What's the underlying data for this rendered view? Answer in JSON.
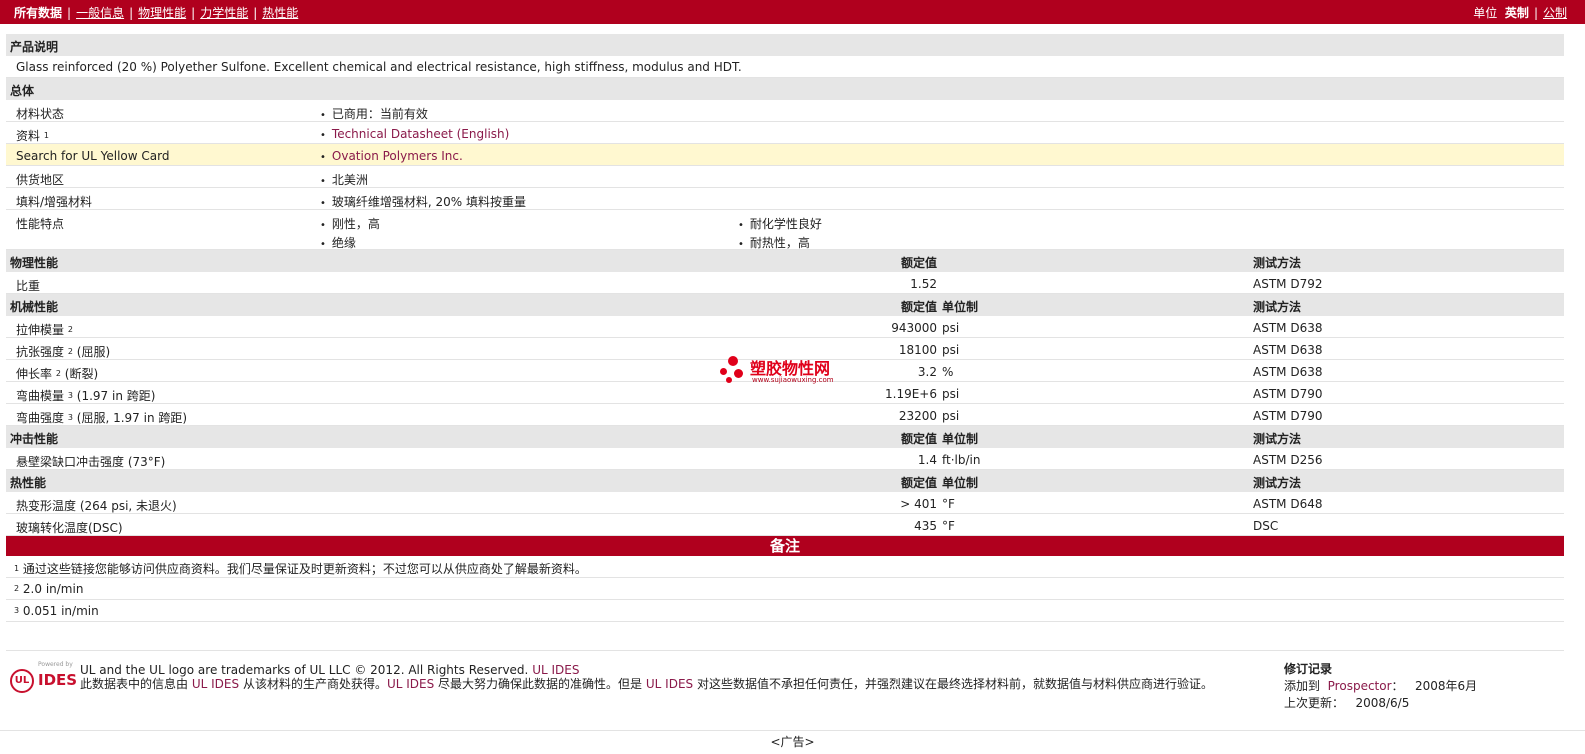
{
  "topbar": {
    "nav": [
      "所有数据",
      "一般信息",
      "物理性能",
      "力学性能",
      "热性能"
    ],
    "units_label": "单位",
    "unit_en": "英制",
    "unit_metric": "公制"
  },
  "desc_section": {
    "title": "产品说明",
    "text": "Glass reinforced (20 %) Polyether Sulfone. Excellent chemical and electrical resistance, high stiffness, modulus and HDT."
  },
  "general": {
    "title": "总体",
    "rows": [
      {
        "label": "材料状态",
        "value": "已商用：当前有效"
      },
      {
        "label": "资料",
        "sup": "1",
        "value": "Technical Datasheet (English)"
      },
      {
        "label": "Search for UL Yellow Card",
        "value": "Ovation Polymers Inc."
      },
      {
        "label": "供货地区",
        "value": "北美洲"
      },
      {
        "label": "填料/增强材料",
        "value": "玻璃纤维增强材料, 20% 填料按重量"
      }
    ],
    "features": {
      "label": "性能特点",
      "items": [
        "刚性，高",
        "绝缘",
        "耐化学性良好",
        "耐热性，高"
      ]
    }
  },
  "physical": {
    "title": "物理性能",
    "col_value": "额定值",
    "col_test": "测试方法",
    "rows": [
      {
        "label": "比重",
        "value": "1.52",
        "unit": "",
        "test": "ASTM D792"
      }
    ]
  },
  "mechanical": {
    "title": "机械性能",
    "col_value": "额定值",
    "col_unit": "单位制",
    "col_test": "测试方法",
    "rows": [
      {
        "label": "拉伸模量",
        "sup": "2",
        "note": "",
        "value": "943000",
        "unit": "psi",
        "test": "ASTM D638"
      },
      {
        "label": "抗张强度",
        "sup": "2",
        "note": "(屈服)",
        "value": "18100",
        "unit": "psi",
        "test": "ASTM D638"
      },
      {
        "label": "伸长率",
        "sup": "2",
        "note": "(断裂)",
        "value": "3.2",
        "unit": "%",
        "test": "ASTM D638"
      },
      {
        "label": "弯曲模量",
        "sup": "3",
        "note": "(1.97 in 跨距)",
        "value": "1.19E+6",
        "unit": "psi",
        "test": "ASTM D790"
      },
      {
        "label": "弯曲强度",
        "sup": "3",
        "note": "(屈服, 1.97 in 跨距)",
        "value": "23200",
        "unit": "psi",
        "test": "ASTM D790"
      }
    ]
  },
  "impact": {
    "title": "冲击性能",
    "col_value": "额定值",
    "col_unit": "单位制",
    "col_test": "测试方法",
    "rows": [
      {
        "label": "悬壁梁缺口冲击强度 (73°F)",
        "value": "1.4",
        "unit": "ft·lb/in",
        "test": "ASTM D256"
      }
    ]
  },
  "thermal": {
    "title": "热性能",
    "col_value": "额定值",
    "col_unit": "单位制",
    "col_test": "测试方法",
    "rows": [
      {
        "label": "热变形温度 (264 psi, 未退火)",
        "value": "> 401",
        "unit": "°F",
        "test": "ASTM D648"
      },
      {
        "label": "玻璃转化温度(DSC)",
        "value": "435",
        "unit": "°F",
        "test": "DSC"
      }
    ]
  },
  "notes": {
    "title": "备注",
    "items": [
      {
        "sup": "1",
        "text": "通过这些链接您能够访问供应商资料。我们尽量保证及时更新资料；不过您可以从供应商处了解最新资料。"
      },
      {
        "sup": "2",
        "text": "2.0 in/min"
      },
      {
        "sup": "3",
        "text": "0.051 in/min"
      }
    ]
  },
  "watermark": {
    "title": "塑胶物性网",
    "url": "www.sujiaowuxing.com"
  },
  "footer": {
    "logo_powered": "Powered by",
    "logo_ul": "UL",
    "logo_ides": "IDES",
    "line1_prefix": "UL and the UL logo are trademarks of UL LLC © 2012. All Rights Reserved.",
    "line1_link": "UL IDES",
    "line2_a": "此数据表中的信息由",
    "line2_link1": "UL IDES",
    "line2_b": "从该材料的生产商处获得。",
    "line2_link2": "UL IDES",
    "line2_c": "尽最大努力确保此数据的准确性。但是",
    "line2_link3": "UL IDES",
    "line2_d": "对这些数据值不承担任何责任，并强烈建议在最终选择材料前，就数据值与材料供应商进行验证。",
    "revision_title": "修订记录",
    "added_label": "添加到",
    "added_link": "Prospector",
    "added_suffix": "：",
    "added_date": "2008年6月",
    "updated_label": "上次更新：",
    "updated_date": "2008/6/5"
  },
  "ad_label": "<广告>"
}
